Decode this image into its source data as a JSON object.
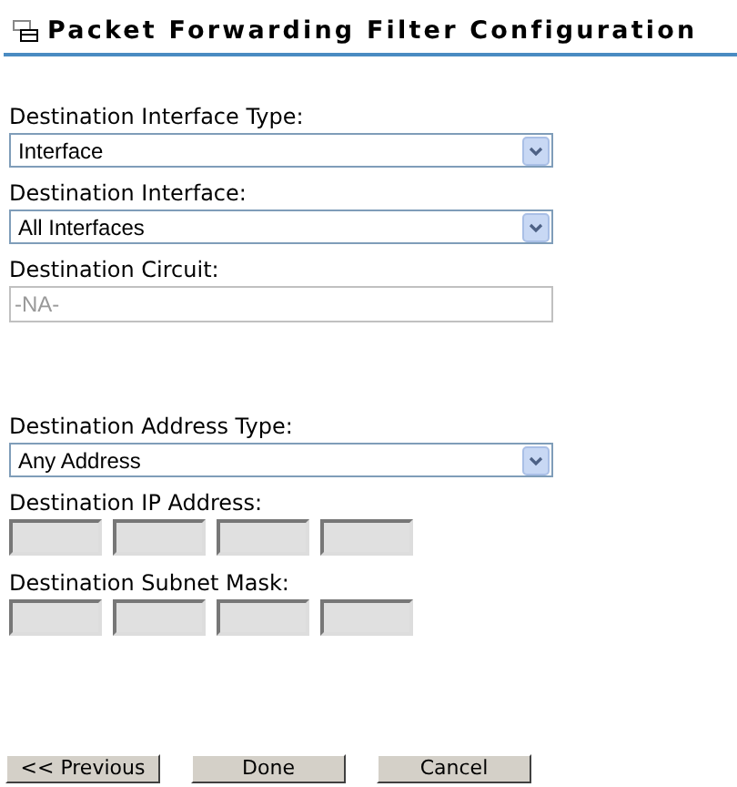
{
  "title": "Packet Forwarding Filter Configuration",
  "fields": [
    {
      "kind": "select",
      "label": "Destination Interface Type:",
      "value": "Interface",
      "disabled": false
    },
    {
      "kind": "select",
      "label": "Destination Interface:",
      "value": "All Interfaces",
      "disabled": false
    },
    {
      "kind": "text",
      "label": "Destination Circuit:",
      "value": "-NA-",
      "disabled": true
    },
    {
      "kind": "spacer"
    },
    {
      "kind": "select",
      "label": "Destination Address Type:",
      "value": "Any Address",
      "disabled": false
    },
    {
      "kind": "octets",
      "label": "Destination IP Address:",
      "disabled": true
    },
    {
      "kind": "octets",
      "label": "Destination Subnet Mask:",
      "disabled": true
    }
  ],
  "buttons": [
    "<< Previous",
    "Done",
    "Cancel"
  ]
}
